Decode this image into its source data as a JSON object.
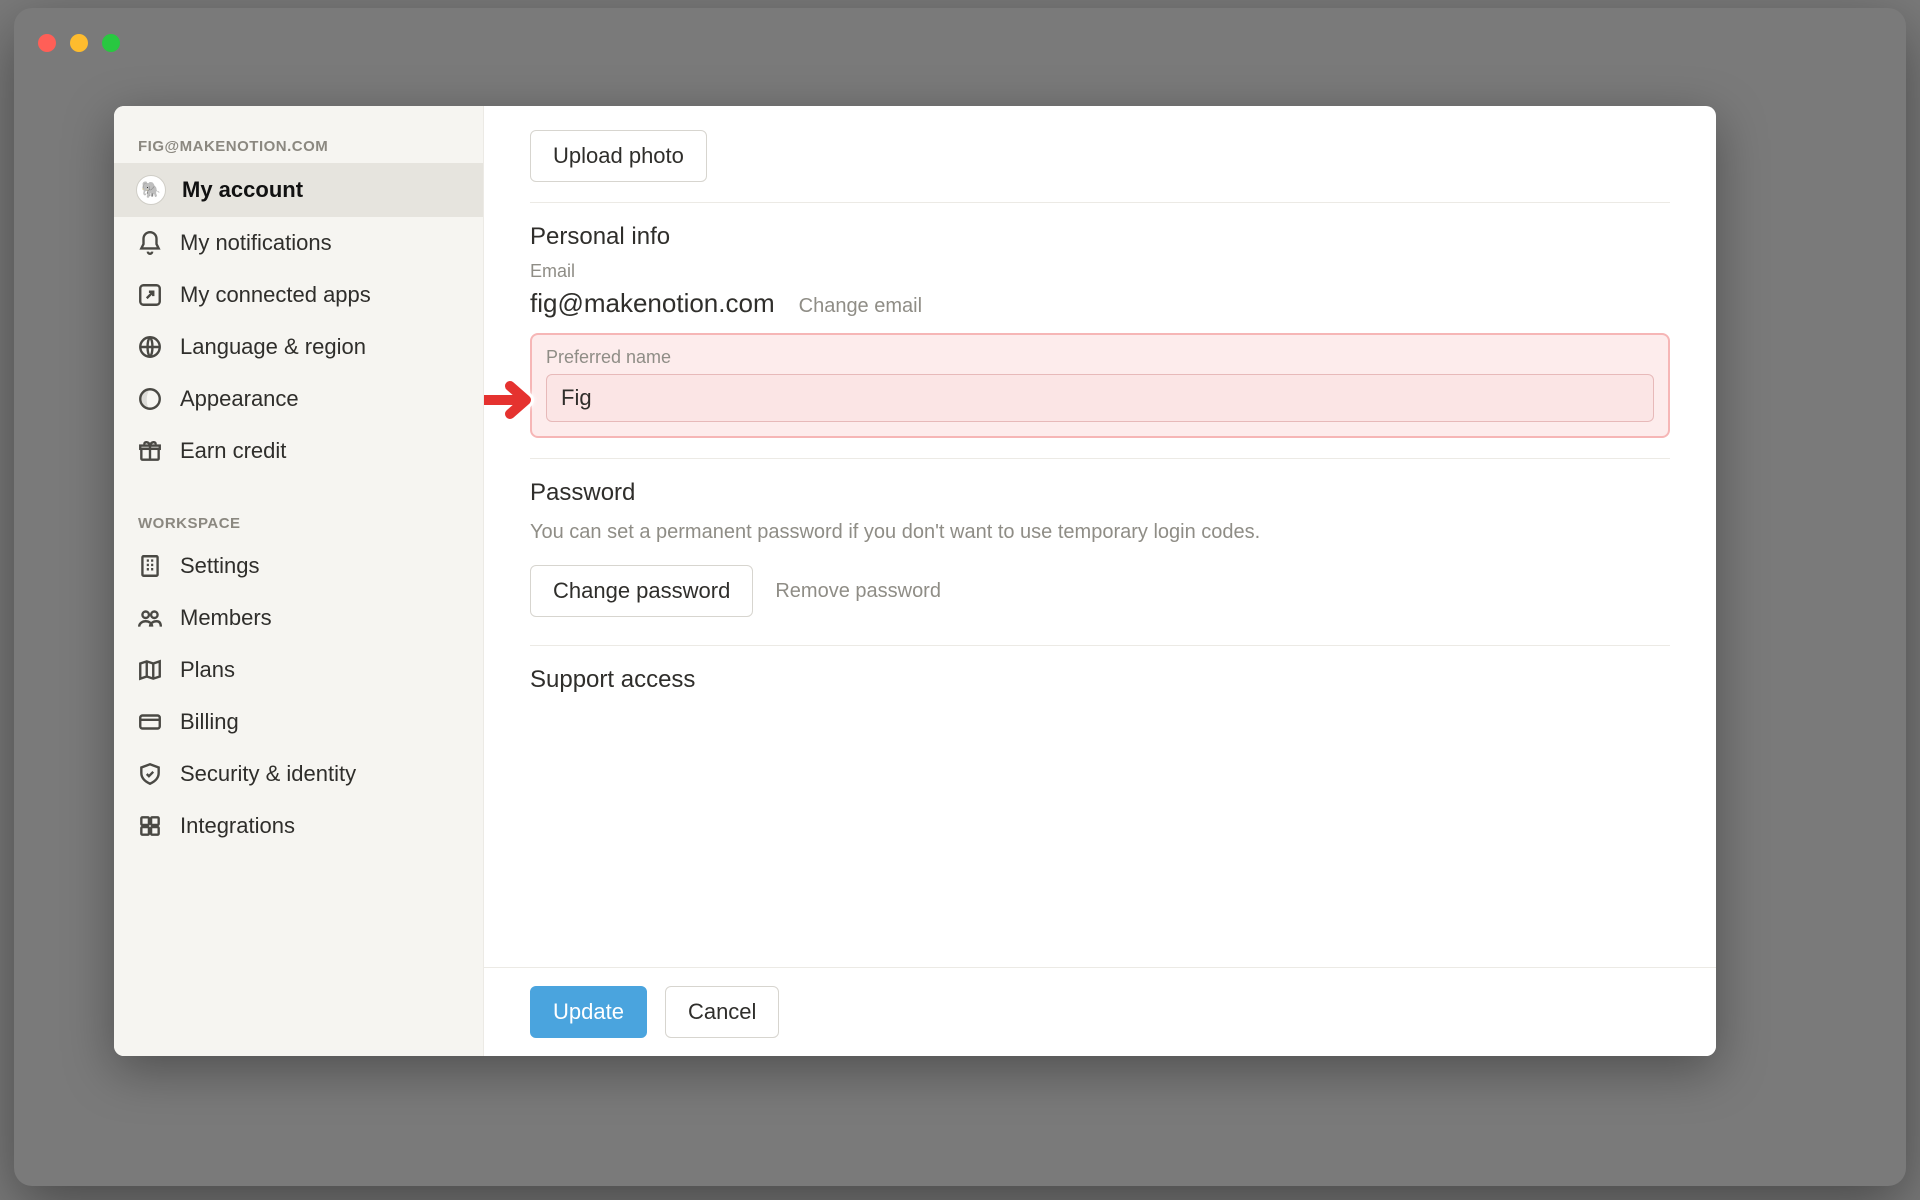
{
  "sidebar": {
    "user_header": "FIG@MAKENOTION.COM",
    "account_items": [
      {
        "label": "My account"
      },
      {
        "label": "My notifications"
      },
      {
        "label": "My connected apps"
      },
      {
        "label": "Language & region"
      },
      {
        "label": "Appearance"
      },
      {
        "label": "Earn credit"
      }
    ],
    "workspace_header": "WORKSPACE",
    "workspace_items": [
      {
        "label": "Settings"
      },
      {
        "label": "Members"
      },
      {
        "label": "Plans"
      },
      {
        "label": "Billing"
      },
      {
        "label": "Security & identity"
      },
      {
        "label": "Integrations"
      }
    ]
  },
  "main": {
    "upload_photo_label": "Upload photo",
    "personal_info_title": "Personal info",
    "email_label": "Email",
    "email_value": "fig@makenotion.com",
    "change_email_label": "Change email",
    "preferred_name_label": "Preferred name",
    "preferred_name_value": "Fig",
    "password_title": "Password",
    "password_desc": "You can set a permanent password if you don't want to use temporary login codes.",
    "change_password_label": "Change password",
    "remove_password_label": "Remove password",
    "support_access_title": "Support access"
  },
  "footer": {
    "update_label": "Update",
    "cancel_label": "Cancel"
  }
}
